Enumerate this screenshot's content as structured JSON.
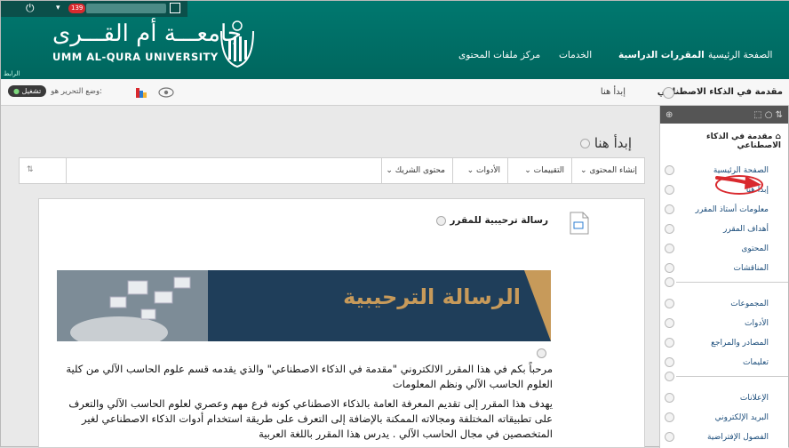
{
  "header": {
    "notif_count": "139",
    "brand_ar": "جامعـــة أم القـــرى",
    "brand_en": "UMM AL-QURA UNIVERSITY",
    "tiny_left": "الرابط",
    "nav": [
      "الصفحة الرئيسية",
      "المقررات الدراسية",
      "الخدمات",
      "مركز ملفات المحتوى"
    ]
  },
  "subbar": {
    "course_title": "مقدمة في الذكاء الاصطناعي",
    "breadcrumb": "إبدأ هنا",
    "edit_mode_label": "وضع التحرير هو:",
    "edit_mode_state": "تشغيل"
  },
  "main": {
    "page_title": "إبدأ هنا",
    "actions": [
      "إنشاء المحتوى",
      "التقييمات",
      "الأدوات",
      "محتوى الشريك"
    ],
    "item_title": "رسالة ترحيبية للمقرر",
    "banner_text": "الرسالة الترحيبية",
    "paragraphs": [
      "مرحباً بكم في هذا المقرر الالكتروني \"مقدمة في الذكاء الاصطناعي\" والذي يقدمه قسم علوم الحاسب الآلي من كلية العلوم الحاسب الآلي ونظم المعلومات",
      "يهدف هذا المقرر إلى تقديم المعرفة العامة بالذكاء الاصطناعي كونه فرع مهم وعصري لعلوم الحاسب الآلي والتعرف على تطبيقاته المختلفة ومجالاته الممكنة بالإضافة إلى التعرف على طريقة استخدام أدوات الذكاء الاصطناعي لغير المتخصصين في مجال الحاسب الآلي . يدرس هذا المقرر باللغة العربية"
    ]
  },
  "sidebar": {
    "course_title": "مقدمة في الذكاء الاصطناعي",
    "group1": [
      "الصفحة الرئيسية",
      "إبدأ هنا",
      "معلومات أستاذ المقرر",
      "أهداف المقرر",
      "المحتوى",
      "المناقشات"
    ],
    "group2": [
      "المجموعات",
      "الأدوات",
      "المصادر والمراجع",
      "تعليمات"
    ],
    "group3": [
      "الإعلانات",
      "البريد الإلكتروني",
      "الفصول الإفتراضية"
    ]
  },
  "colors": {
    "header": "#00706a",
    "accent_red": "#d9292e",
    "banner_bg": "#1f3e5a",
    "banner_gold": "#c79a5a"
  }
}
